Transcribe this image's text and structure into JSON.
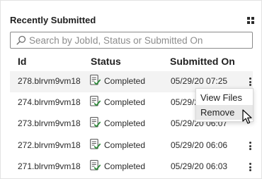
{
  "panel": {
    "title": "Recently Submitted",
    "layout_icon": "grid-view-icon"
  },
  "search": {
    "placeholder": "Search by JobId, Status or Submitted On",
    "value": ""
  },
  "table": {
    "columns": [
      "Id",
      "Status",
      "Submitted On"
    ],
    "rows": [
      {
        "id": "278.blrvm9vm18",
        "status": "Completed",
        "submitted_on": "05/29/20 07:25"
      },
      {
        "id": "274.blrvm9vm18",
        "status": "Completed",
        "submitted_on": "05/29/20 07:24"
      },
      {
        "id": "273.blrvm9vm18",
        "status": "Completed",
        "submitted_on": "05/29/20 06:07"
      },
      {
        "id": "272.blrvm9vm18",
        "status": "Completed",
        "submitted_on": "05/29/20 06:06"
      },
      {
        "id": "271.blrvm9vm18",
        "status": "Completed",
        "submitted_on": "05/29/20 06:03"
      }
    ],
    "status_icon": "completed-checklist-icon",
    "row_menu_icon": "more-vertical-icon"
  },
  "context_menu": {
    "items": [
      "View Files",
      "Remove"
    ],
    "highlighted": "Remove"
  },
  "colors": {
    "status_check": "#2e8b3a",
    "hover_row": "#f3f3f3",
    "menu_highlight": "#e8e8e8"
  }
}
